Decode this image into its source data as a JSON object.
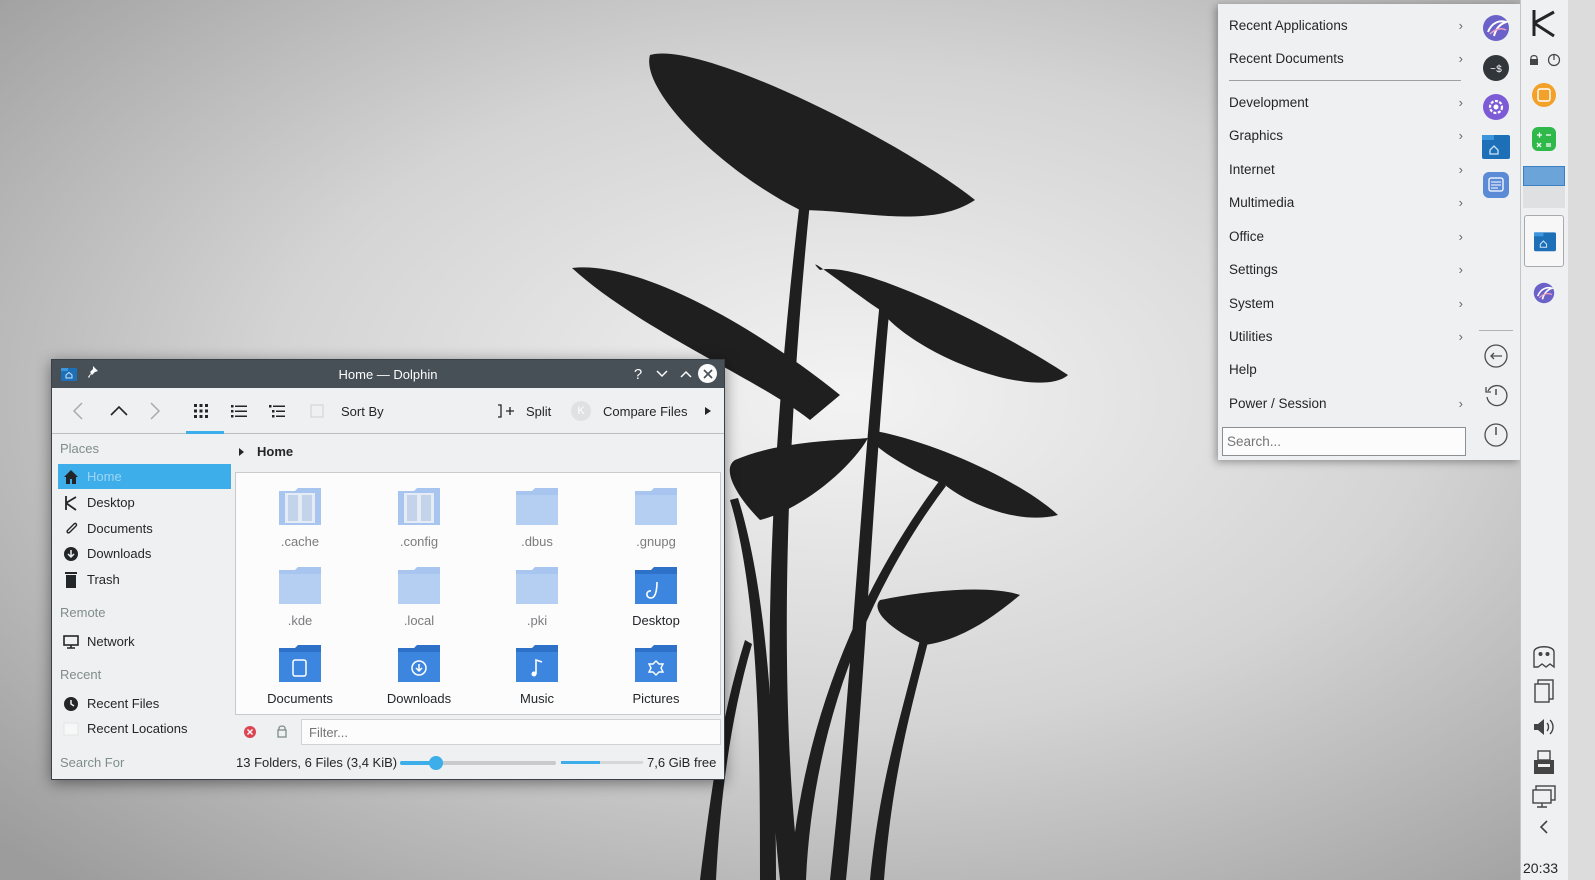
{
  "dolphin": {
    "title": "Home — Dolphin",
    "toolbar": {
      "sort_label": "Sort By",
      "split_label": "Split",
      "compare_label": "Compare Files"
    },
    "places": {
      "sections": {
        "places": "Places",
        "remote": "Remote",
        "recent": "Recent",
        "search": "Search For"
      },
      "items": [
        {
          "label": "Home",
          "icon": "home-icon"
        },
        {
          "label": "Desktop",
          "icon": "desktop-icon"
        },
        {
          "label": "Documents",
          "icon": "documents-icon"
        },
        {
          "label": "Downloads",
          "icon": "downloads-icon"
        },
        {
          "label": "Trash",
          "icon": "trash-icon"
        }
      ],
      "remote_items": [
        {
          "label": "Network",
          "icon": "network-icon"
        }
      ],
      "recent_items": [
        {
          "label": "Recent Files",
          "icon": "clock-icon"
        },
        {
          "label": "Recent Locations",
          "icon": "location-icon"
        }
      ]
    },
    "breadcrumb": "Home",
    "files": [
      {
        "name": ".cache"
      },
      {
        "name": ".config"
      },
      {
        "name": ".dbus"
      },
      {
        "name": ".gnupg"
      },
      {
        "name": ".kde"
      },
      {
        "name": ".local"
      },
      {
        "name": ".pki"
      },
      {
        "name": "Desktop"
      },
      {
        "name": "Documents"
      },
      {
        "name": "Downloads"
      },
      {
        "name": "Music"
      },
      {
        "name": "Pictures"
      }
    ],
    "filter_placeholder": "Filter...",
    "status": "13 Folders, 6 Files (3,4 KiB)",
    "zoom_level": 0.23,
    "free_space_used_fraction": 0.48,
    "free_space": "7,6 GiB free"
  },
  "launcher": {
    "items": [
      {
        "label": "Recent Applications",
        "submenu": true
      },
      {
        "label": "Recent Documents",
        "submenu": true
      },
      {
        "label": "Development",
        "submenu": true
      },
      {
        "label": "Graphics",
        "submenu": true
      },
      {
        "label": "Internet",
        "submenu": true
      },
      {
        "label": "Multimedia",
        "submenu": true
      },
      {
        "label": "Office",
        "submenu": true
      },
      {
        "label": "Settings",
        "submenu": true
      },
      {
        "label": "System",
        "submenu": true
      },
      {
        "label": "Utilities",
        "submenu": true
      },
      {
        "label": "Help",
        "submenu": false
      },
      {
        "label": "Power / Session",
        "submenu": true
      }
    ],
    "search_placeholder": "Search...",
    "favorites": [
      "app-icon",
      "terminal-icon",
      "settings-icon",
      "file-manager-icon",
      "text-editor-icon"
    ],
    "session_buttons": [
      "logout-icon",
      "restart-icon",
      "shutdown-icon"
    ]
  },
  "panel": {
    "clock": "20:33",
    "colors": {
      "accent": "#3daee9",
      "titlebar": "#475057"
    }
  }
}
